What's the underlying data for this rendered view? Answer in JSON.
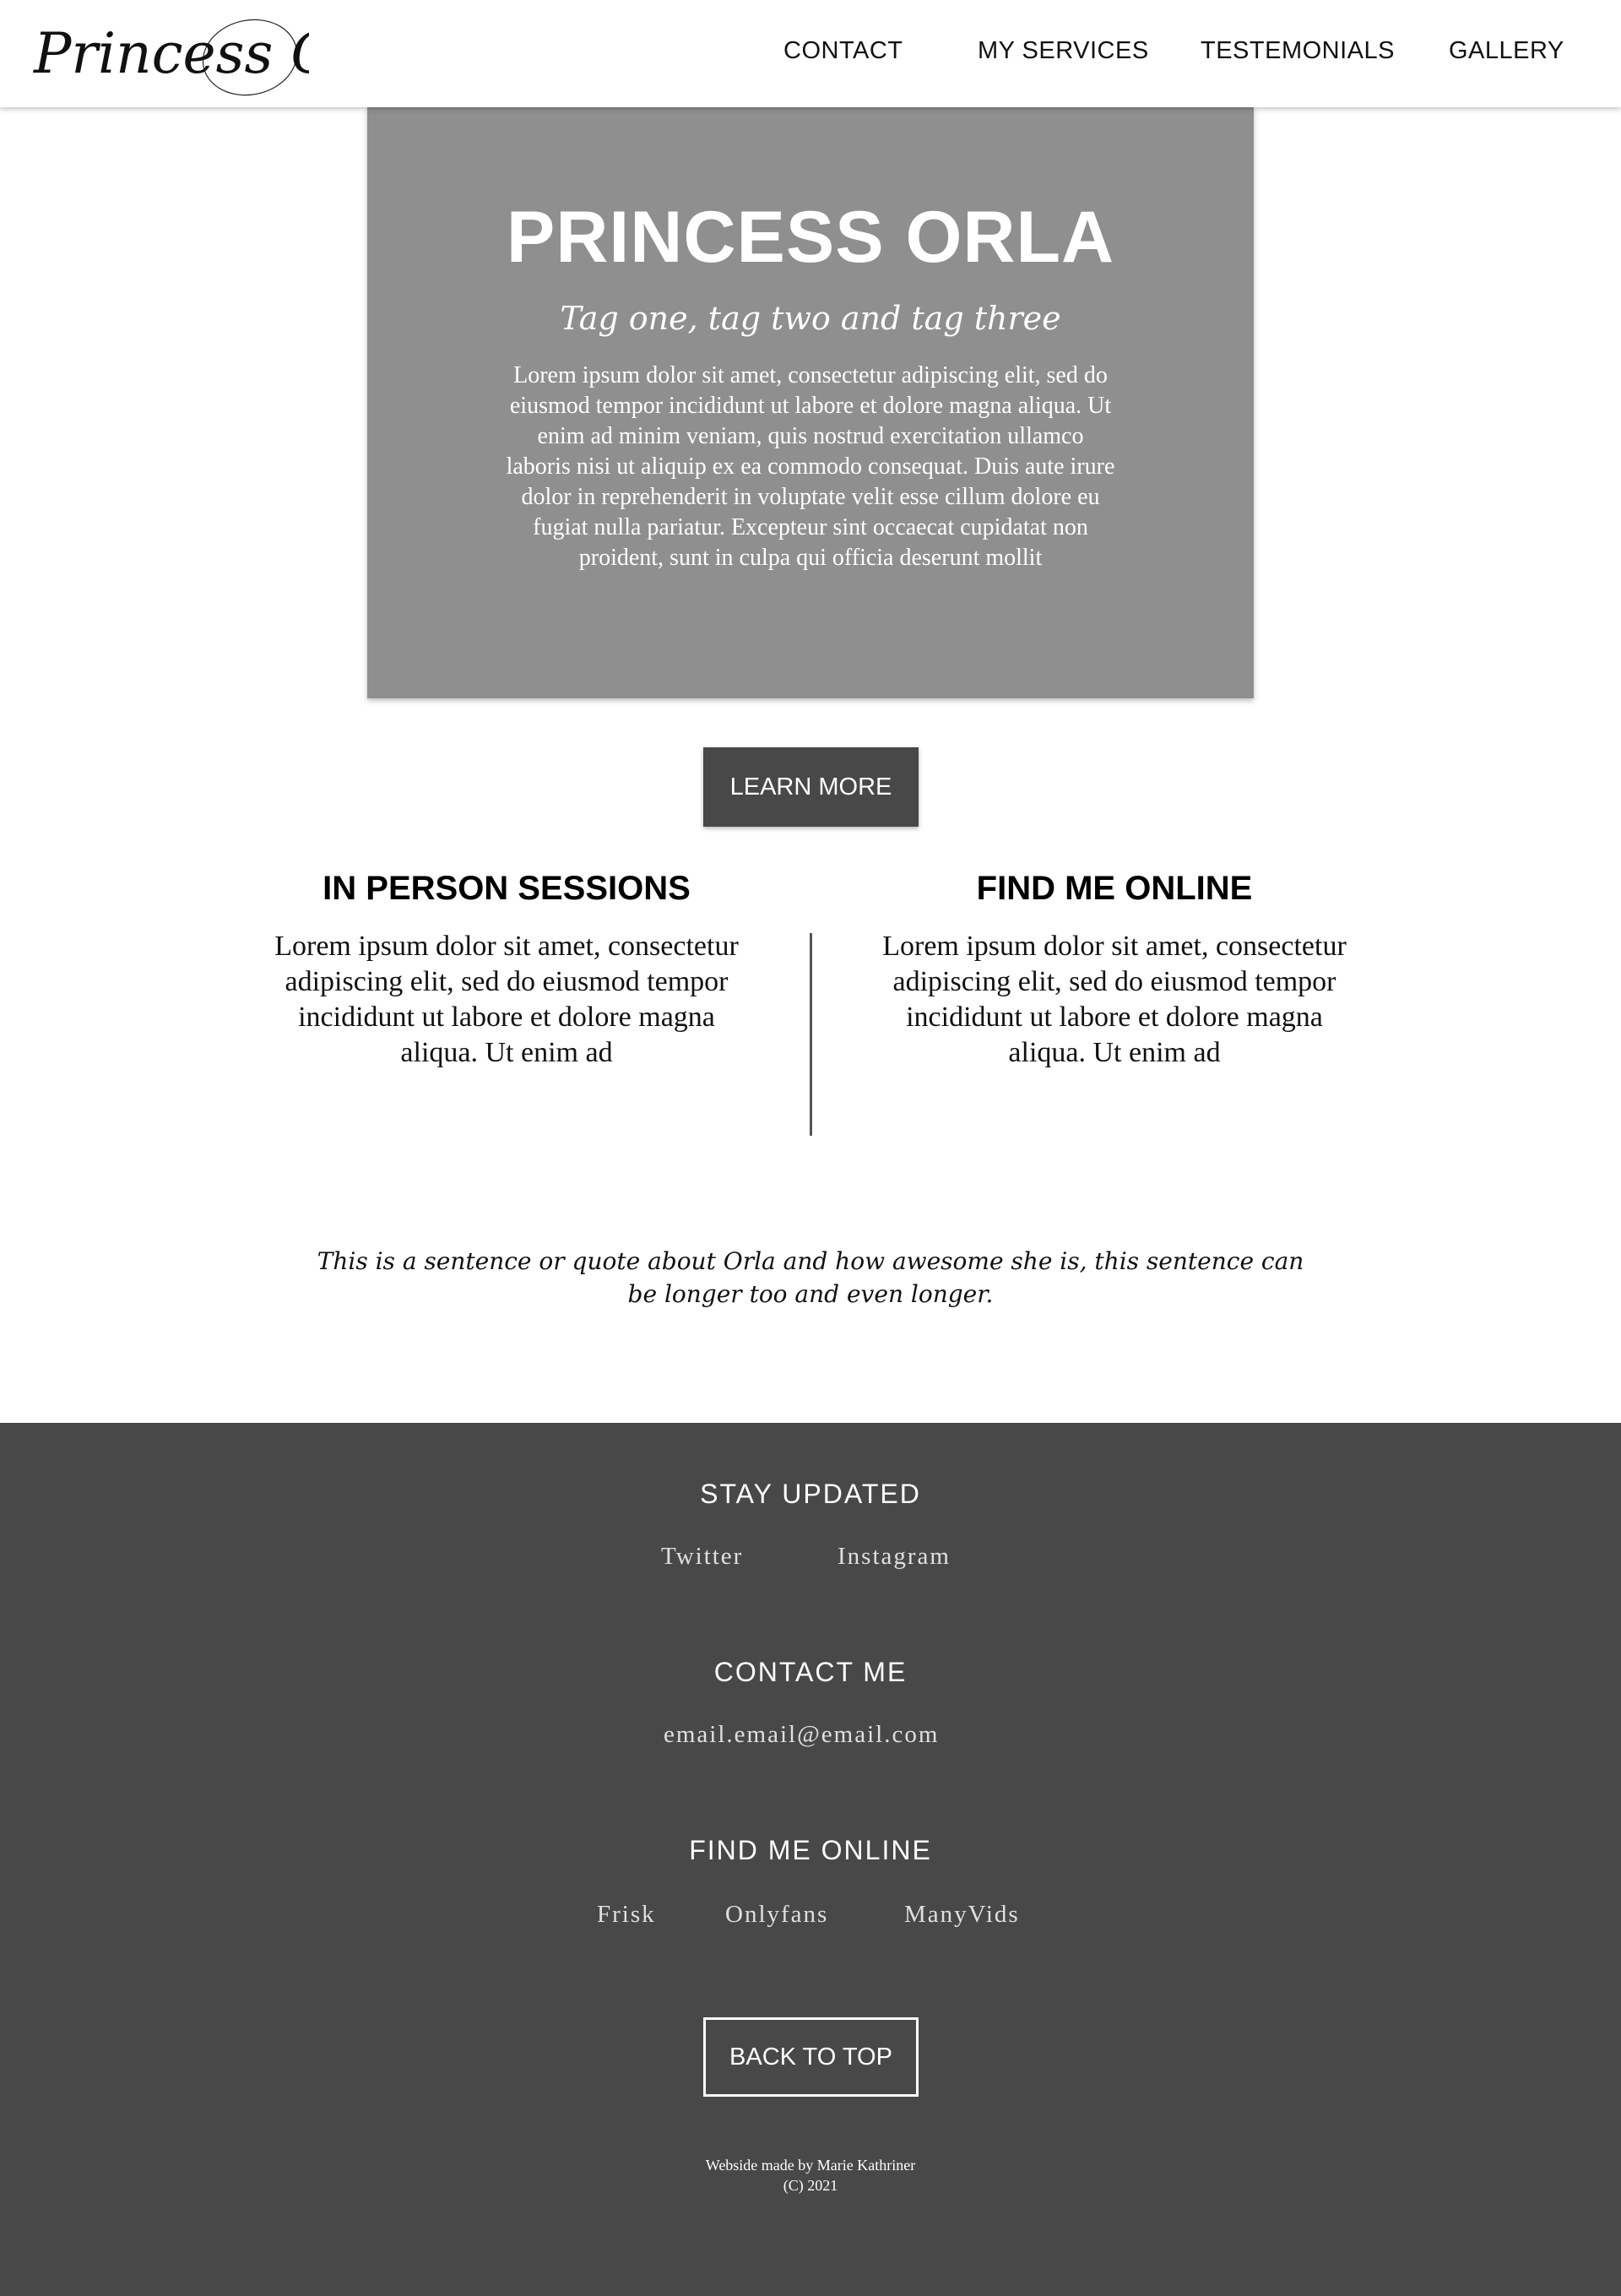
{
  "header": {
    "logo_text": "Princess Orla",
    "nav": [
      "CONTACT",
      "MY SERVICES",
      "TESTEMONIALS",
      "GALLERY"
    ]
  },
  "hero": {
    "title": "PRINCESS ORLA",
    "tags": "Tag one, tag two and tag three",
    "body": "Lorem ipsum dolor sit amet, consectetur adipiscing elit, sed do eiusmod tempor incididunt ut labore et dolore magna aliqua. Ut enim ad minim veniam, quis nostrud exercitation ullamco laboris nisi ut aliquip ex ea commodo consequat. Duis aute irure dolor in reprehenderit in voluptate velit esse cillum dolore eu fugiat nulla pariatur. Excepteur sint occaecat cupidatat non proident, sunt in culpa qui officia deserunt mollit"
  },
  "learn_more_label": "LEARN MORE",
  "columns": [
    {
      "title": "IN PERSON SESSIONS",
      "body": "Lorem ipsum dolor sit amet, consectetur adipiscing elit, sed do eiusmod tempor incididunt ut labore et dolore magna aliqua. Ut enim ad"
    },
    {
      "title": "FIND ME ONLINE",
      "body": "Lorem ipsum dolor sit amet, consectetur adipiscing elit, sed do eiusmod tempor incididunt ut labore et dolore magna aliqua. Ut enim ad"
    }
  ],
  "quote": "This is a sentence or quote about Orla and how awesome she is, this sentence can be longer too and even longer.",
  "footer": {
    "stay_updated": {
      "heading": "STAY UPDATED",
      "links": [
        "Twitter",
        "Instagram"
      ]
    },
    "contact": {
      "heading": "CONTACT ME",
      "email": "email.email@email.com"
    },
    "find_online": {
      "heading": "FIND ME ONLINE",
      "links": [
        "Frisk",
        "Onlyfans",
        "ManyVids"
      ]
    },
    "back_to_top_label": "BACK TO TOP",
    "credit_line1": "Webside made by Marie Kathriner",
    "credit_line2": "(C) 2021"
  },
  "colors": {
    "hero_bg": "#8f8f8f",
    "footer_bg": "#484848",
    "button_bg": "#484848"
  }
}
